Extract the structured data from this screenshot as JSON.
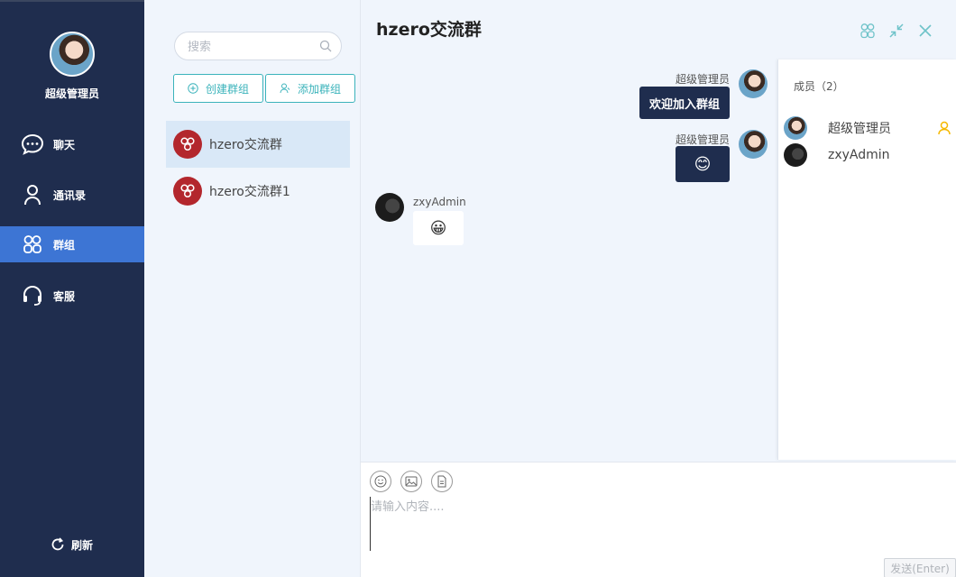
{
  "sidebar": {
    "user_name": "超级管理员",
    "items": [
      {
        "label": "聊天",
        "icon": "chat-bubble-icon"
      },
      {
        "label": "通讯录",
        "icon": "person-icon"
      },
      {
        "label": "群组",
        "icon": "group-icon"
      },
      {
        "label": "客服",
        "icon": "headset-icon"
      }
    ],
    "active_item": "群组",
    "refresh_label": "刷新"
  },
  "list": {
    "search_placeholder": "搜索",
    "create_group_label": "创建群组",
    "add_group_label": "添加群组",
    "groups": [
      {
        "name": "hzero交流群",
        "selected": true
      },
      {
        "name": "hzero交流群1",
        "selected": false
      }
    ]
  },
  "chat": {
    "title": "hzero交流群",
    "messages": [
      {
        "sender": "超级管理员",
        "text": "欢迎加入群组",
        "side": "right"
      },
      {
        "sender": "超级管理员",
        "text": "😊",
        "side": "right"
      },
      {
        "sender": "zxyAdmin",
        "text": "😀",
        "side": "left"
      }
    ]
  },
  "members": {
    "title": "成员（2）",
    "list": [
      {
        "name": "超级管理员",
        "owner": true
      },
      {
        "name": "zxyAdmin",
        "owner": false
      }
    ]
  },
  "composer": {
    "placeholder": "请输入内容....",
    "send_label": "发送(Enter)"
  },
  "colors": {
    "sidebar_bg": "#1f2d4e",
    "active_nav": "#3d75d4",
    "accent": "#3bb3bb",
    "group_avatar": "#b3272d",
    "owner_icon": "#f5b800"
  }
}
